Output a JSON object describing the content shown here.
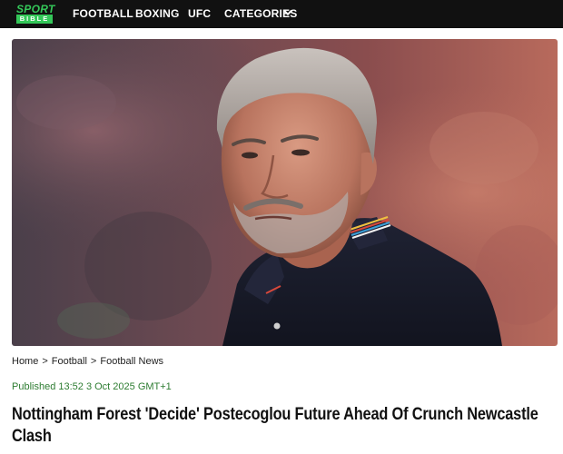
{
  "header": {
    "logo_top": "SPORT",
    "logo_bottom": "BIBLE",
    "nav": {
      "football": "FOOTBALL",
      "boxing": "BOXING",
      "ufc": "UFC",
      "categories": "CATEGORIES"
    },
    "chevron_icon": "chevron-down-icon",
    "brand_color": "#34c759",
    "bar_color": "#111111"
  },
  "breadcrumb": {
    "home": "Home",
    "football": "Football",
    "football_news": "Football News",
    "separator": ">"
  },
  "article": {
    "published": "Published 13:52 3 Oct 2025 GMT+1",
    "headline": "Nottingham Forest 'Decide' Postecoglou Future Ahead Of Crunch Newcastle Clash"
  }
}
